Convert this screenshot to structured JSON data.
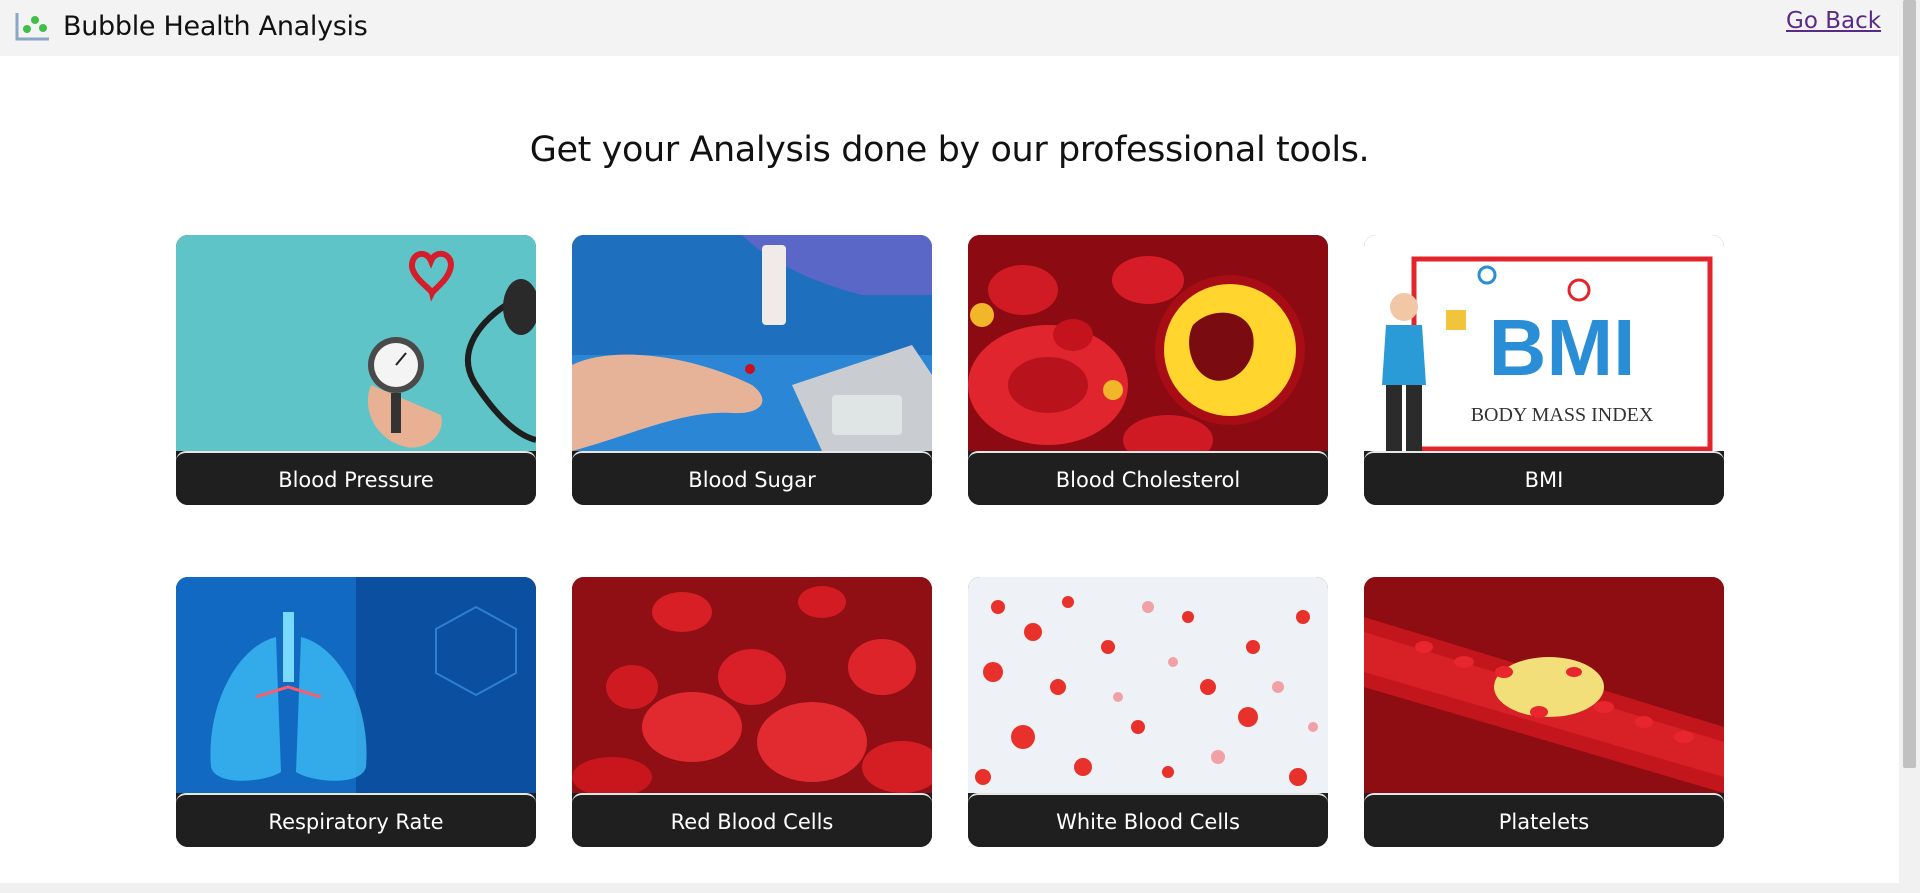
{
  "header": {
    "brand_name": "Bubble Health Analysis",
    "go_back_label": "Go Back"
  },
  "main": {
    "headline": "Get your Analysis done by our professional tools.",
    "cards": [
      {
        "label": "Blood Pressure",
        "image_text": ""
      },
      {
        "label": "Blood Sugar",
        "image_text": ""
      },
      {
        "label": "Blood Cholesterol",
        "image_text": ""
      },
      {
        "label": "BMI",
        "image_text": "BMI",
        "image_caption": "BODY MASS INDEX"
      },
      {
        "label": "Respiratory Rate",
        "image_text": ""
      },
      {
        "label": "Red Blood Cells",
        "image_text": ""
      },
      {
        "label": "White Blood Cells",
        "image_text": ""
      },
      {
        "label": "Platelets",
        "image_text": ""
      }
    ]
  },
  "colors": {
    "navbar_bg": "#f3f3f3",
    "card_label_bg": "#1f1f1f",
    "link": "#5b2a86",
    "logo_green": "#3fbf4a"
  },
  "icons": [
    "chart-logo-icon"
  ]
}
